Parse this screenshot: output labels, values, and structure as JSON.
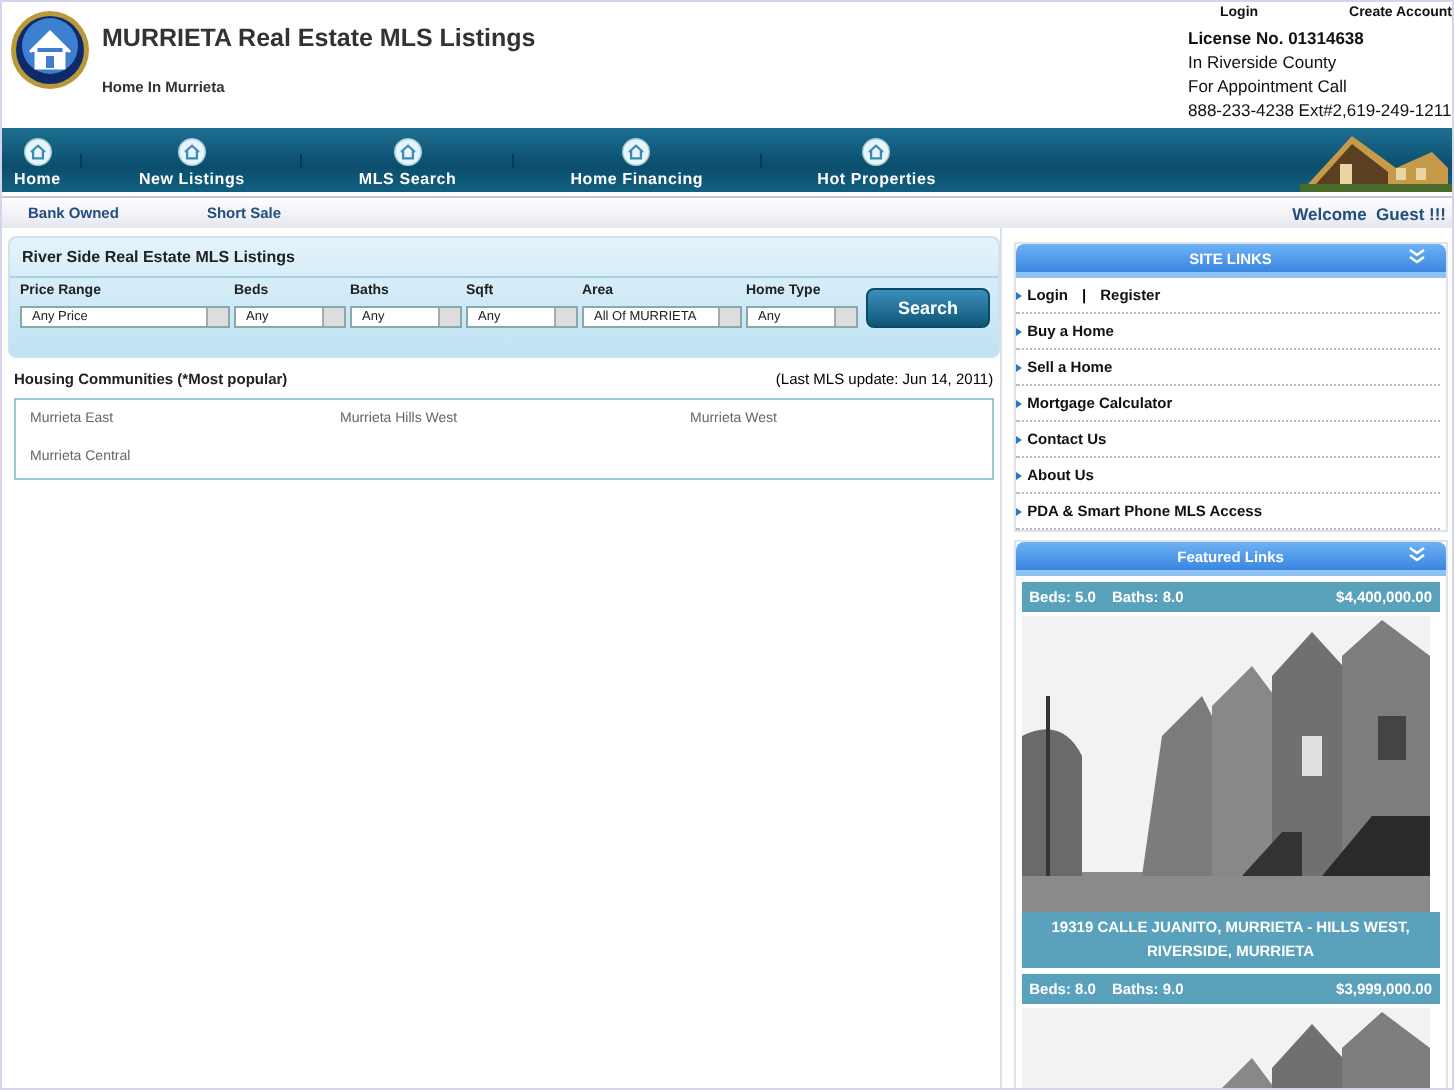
{
  "header": {
    "title": "MURRIETA Real Estate MLS Listings",
    "subtitle": "Home In Murrieta",
    "account_links": [
      "Login",
      "Create Account"
    ],
    "license": "License No. 01314638",
    "contact_lines": [
      "In Riverside County",
      "For Appointment Call",
      "888-233-4238 Ext#2,619-249-1211"
    ]
  },
  "nav": [
    "Home",
    "New Listings",
    "MLS Search",
    "Home Financing",
    "Hot Properties"
  ],
  "sub_links": [
    "Bank Owned",
    "Short Sale"
  ],
  "welcome": "Welcome  Guest !!!",
  "search_panel": {
    "title": "River Side Real Estate MLS Listings",
    "filters": [
      {
        "label": "Price Range",
        "value": "Any Price"
      },
      {
        "label": "Beds",
        "value": "Any"
      },
      {
        "label": "Baths",
        "value": "Any"
      },
      {
        "label": "Sqft",
        "value": "Any"
      },
      {
        "label": "Area",
        "value": "All Of MURRIETA"
      },
      {
        "label": "Home Type",
        "value": "Any"
      }
    ],
    "button": "Search"
  },
  "communities": {
    "title": "Housing Communities (*Most popular)",
    "last_update": "(Last MLS update: Jun 14, 2011)",
    "items": [
      "Murrieta East",
      "Murrieta Hills West",
      "Murrieta West",
      "Murrieta Central"
    ]
  },
  "site_links": {
    "title": "SITE LINKS",
    "separator": "|",
    "items": [
      [
        "Login",
        "Register"
      ],
      [
        "Buy a Home"
      ],
      [
        "Sell a Home"
      ],
      [
        "Mortgage Calculator"
      ],
      [
        "Contact Us"
      ],
      [
        "About Us"
      ],
      [
        "PDA & Smart Phone MLS Access"
      ]
    ]
  },
  "featured": {
    "title": "Featured Links",
    "listings": [
      {
        "beds": "Beds: 5.0",
        "baths": "Baths: 8.0",
        "price": "$4,400,000.00",
        "address": "19319 CALLE JUANITO, MURRIETA - HILLS WEST, RIVERSIDE, MURRIETA"
      },
      {
        "beds": "Beds: 8.0",
        "baths": "Baths: 9.0",
        "price": "$3,999,000.00"
      }
    ]
  }
}
